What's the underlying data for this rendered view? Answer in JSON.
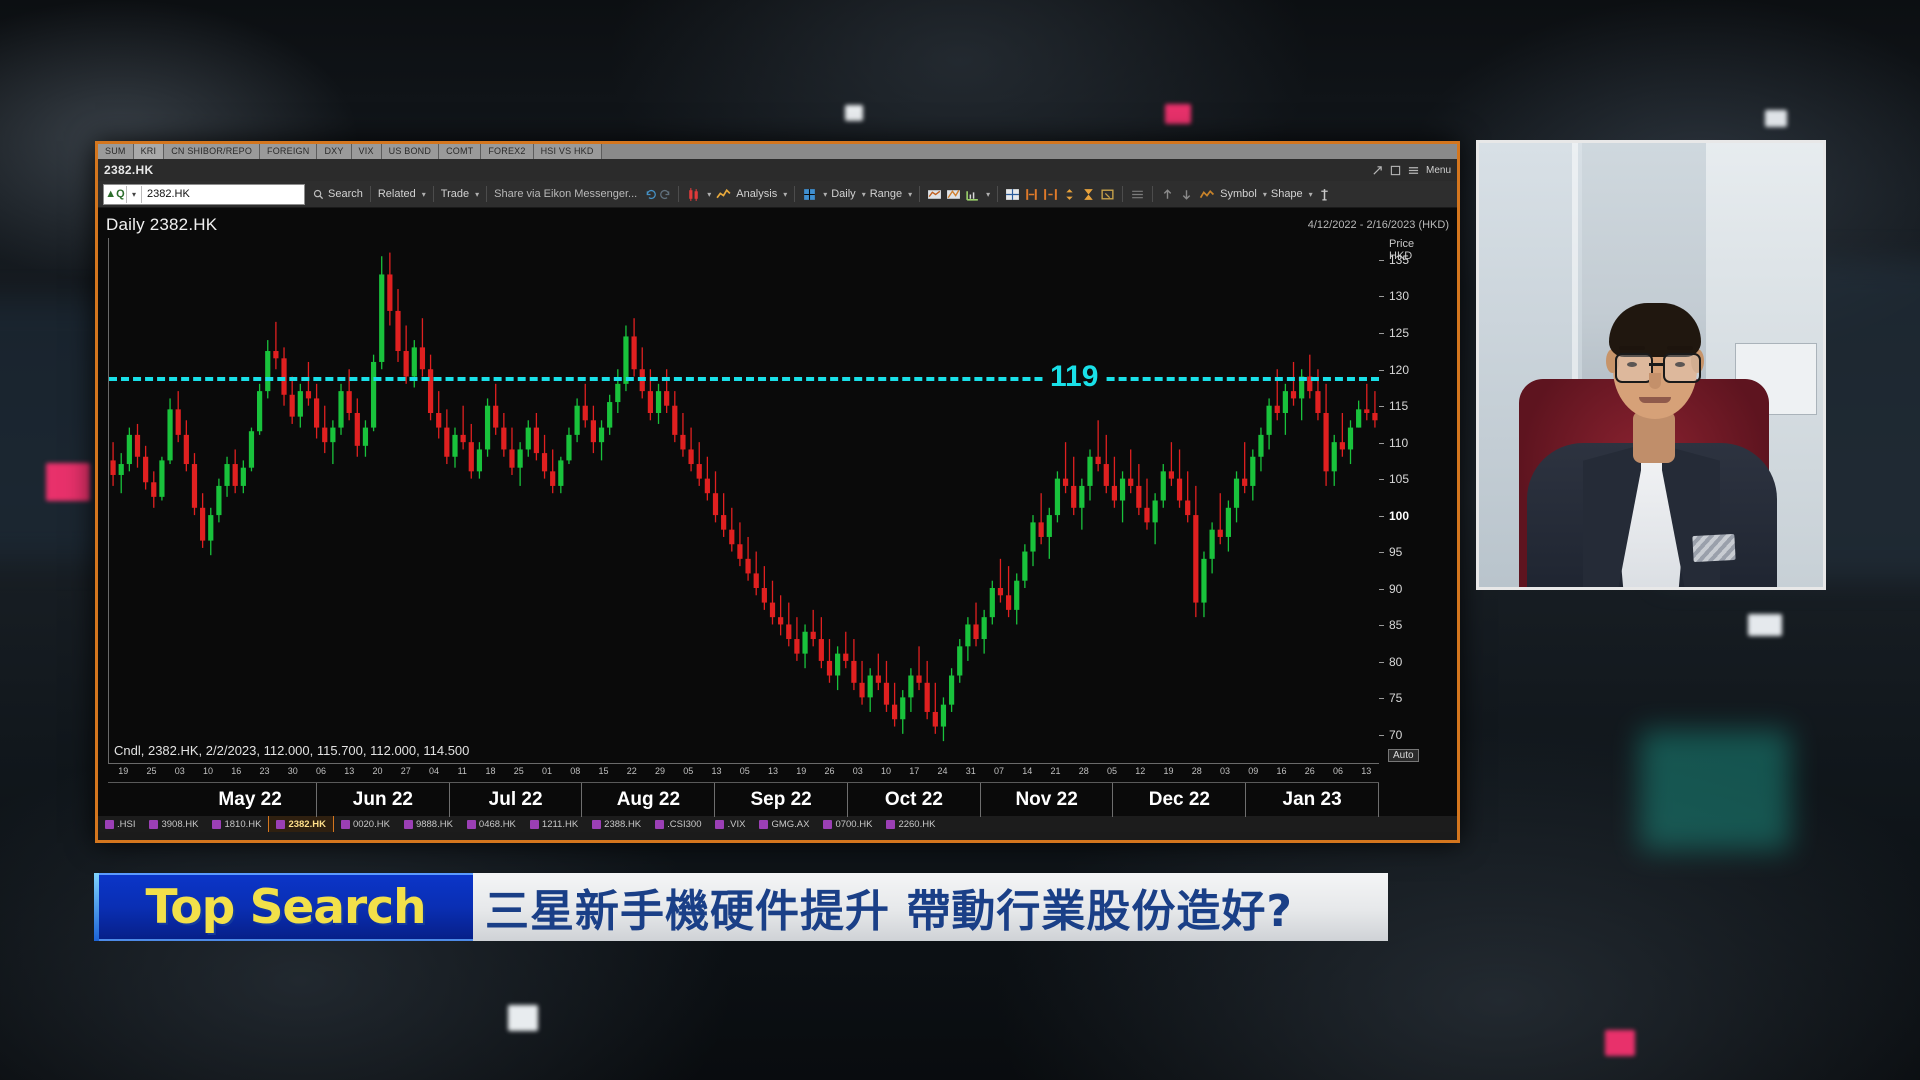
{
  "window": {
    "app_tabs": [
      "SUM",
      "KRI",
      "CN SHIBOR/REPO",
      "FOREIGN",
      "DXY",
      "VIX",
      "US BOND",
      "COMT",
      "FOREX2",
      "HSI VS HKD"
    ],
    "selected_app_tab": "KRI",
    "title": "2382.HK",
    "menu_label": "Menu"
  },
  "toolbar": {
    "quote_icon": "up-arrow-green",
    "search_symbol_value": "2382.HK",
    "search_label": "Search",
    "related_label": "Related",
    "trade_label": "Trade",
    "share_label": "Share via Eikon Messenger...",
    "analysis_label": "Analysis",
    "interval_label": "Daily",
    "range_label": "Range",
    "symbol_label": "Symbol",
    "shape_label": "Shape"
  },
  "chart_header": {
    "title": "Daily 2382.HK",
    "date_range": "4/12/2022 - 2/16/2023 (HKD)"
  },
  "chart_footer": {
    "ohlc_line": "Cndl, 2382.HK, 2/2/2023, 112.000, 115.700, 112.000, 114.500",
    "auto_label": "Auto"
  },
  "price_axis": {
    "header_line1": "Price",
    "header_line2": "HKD",
    "ticks": [
      135,
      130,
      125,
      120,
      115,
      110,
      105,
      100,
      95,
      90,
      85,
      80,
      75,
      70
    ],
    "bold_tick": 100
  },
  "level_line": {
    "label": "119",
    "value": 119,
    "color": "#19e0e8"
  },
  "ticker_bar": {
    "items": [
      ".HSI",
      "3908.HK",
      "1810.HK",
      "2382.HK",
      "0020.HK",
      "9888.HK",
      "0468.HK",
      "1211.HK",
      "2388.HK",
      ".CSI300",
      ".VIX",
      "GMG.AX",
      "0700.HK",
      "2260.HK"
    ],
    "selected": "2382.HK"
  },
  "lower_third": {
    "badge": "Top Search",
    "headline": "三星新手機硬件提升 帶動行業股份造好?",
    "badge_bg": "#0a2fb4",
    "badge_fg": "#f2e04a",
    "headline_fg": "#1a3f87"
  },
  "chart_data": {
    "type": "candlestick",
    "title": "Daily 2382.HK",
    "instrument": "2382.HK",
    "currency": "HKD",
    "xlabel": "",
    "ylabel": "Price HKD",
    "ylim": [
      66,
      138
    ],
    "grid": false,
    "date_range": "4/12/2022 - 2/16/2023",
    "month_labels": [
      "May 22",
      "Jun 22",
      "Jul 22",
      "Aug 22",
      "Sep 22",
      "Oct 22",
      "Nov 22",
      "Dec 22",
      "Jan 23"
    ],
    "day_ticks_left": [
      "19",
      "25",
      "03",
      "10",
      "16",
      "23",
      "30",
      "06",
      "13",
      "20",
      "27",
      "04",
      "11",
      "18",
      "25",
      "01",
      "08",
      "15",
      "22",
      "29",
      "05",
      "13"
    ],
    "day_ticks_right": [
      "05",
      "13",
      "19",
      "26",
      "03",
      "10",
      "17",
      "24",
      "31",
      "07",
      "14",
      "21",
      "28",
      "05",
      "12",
      "19",
      "28",
      "03",
      "09",
      "16",
      "26",
      "06",
      "13"
    ],
    "annotations": [
      {
        "type": "horizontal_line",
        "value": 119,
        "label": "119",
        "color": "#19e0e8",
        "style": "dashed"
      }
    ],
    "last_candle": {
      "date": "2/2/2023",
      "open": 112.0,
      "high": 115.7,
      "low": 112.0,
      "close": 114.5
    },
    "ohlc": [
      [
        107.5,
        110.0,
        104.0,
        105.5
      ],
      [
        105.5,
        108.5,
        103.0,
        107.0
      ],
      [
        107.0,
        112.0,
        106.0,
        111.0
      ],
      [
        111.0,
        112.5,
        106.5,
        108.0
      ],
      [
        108.0,
        109.5,
        103.5,
        104.5
      ],
      [
        104.5,
        106.0,
        101.0,
        102.5
      ],
      [
        102.5,
        108.0,
        102.0,
        107.5
      ],
      [
        107.5,
        116.0,
        107.0,
        114.5
      ],
      [
        114.5,
        117.0,
        110.0,
        111.0
      ],
      [
        111.0,
        113.0,
        106.0,
        107.0
      ],
      [
        107.0,
        108.5,
        100.0,
        101.0
      ],
      [
        101.0,
        103.0,
        95.5,
        96.5
      ],
      [
        96.5,
        101.0,
        94.5,
        100.0
      ],
      [
        100.0,
        105.0,
        99.0,
        104.0
      ],
      [
        104.0,
        108.0,
        102.5,
        107.0
      ],
      [
        107.0,
        109.0,
        103.0,
        104.0
      ],
      [
        104.0,
        107.5,
        103.0,
        106.5
      ],
      [
        106.5,
        112.0,
        106.0,
        111.5
      ],
      [
        111.5,
        118.0,
        111.0,
        117.0
      ],
      [
        117.0,
        124.0,
        116.0,
        122.5
      ],
      [
        122.5,
        126.5,
        120.0,
        121.5
      ],
      [
        121.5,
        123.0,
        115.0,
        116.5
      ],
      [
        116.5,
        119.0,
        112.5,
        113.5
      ],
      [
        113.5,
        118.0,
        112.0,
        117.0
      ],
      [
        117.0,
        121.0,
        115.0,
        116.0
      ],
      [
        116.0,
        118.0,
        110.5,
        112.0
      ],
      [
        112.0,
        115.0,
        108.5,
        110.0
      ],
      [
        110.0,
        113.0,
        107.0,
        112.0
      ],
      [
        112.0,
        118.0,
        111.0,
        117.0
      ],
      [
        117.0,
        120.0,
        113.0,
        114.0
      ],
      [
        114.0,
        116.0,
        108.0,
        109.5
      ],
      [
        109.5,
        113.0,
        108.0,
        112.0
      ],
      [
        112.0,
        122.0,
        111.5,
        121.0
      ],
      [
        121.0,
        135.5,
        120.0,
        133.0
      ],
      [
        133.0,
        136.0,
        126.0,
        128.0
      ],
      [
        128.0,
        131.0,
        121.0,
        122.5
      ],
      [
        122.5,
        126.0,
        118.0,
        119.0
      ],
      [
        119.0,
        124.0,
        117.5,
        123.0
      ],
      [
        123.0,
        127.0,
        119.0,
        120.0
      ],
      [
        120.0,
        122.0,
        113.0,
        114.0
      ],
      [
        114.0,
        117.0,
        110.5,
        112.0
      ],
      [
        112.0,
        114.5,
        107.0,
        108.0
      ],
      [
        108.0,
        112.0,
        106.5,
        111.0
      ],
      [
        111.0,
        115.0,
        109.0,
        110.0
      ],
      [
        110.0,
        112.5,
        105.0,
        106.0
      ],
      [
        106.0,
        110.0,
        105.0,
        109.0
      ],
      [
        109.0,
        116.0,
        108.0,
        115.0
      ],
      [
        115.0,
        118.0,
        111.0,
        112.0
      ],
      [
        112.0,
        114.0,
        108.0,
        109.0
      ],
      [
        109.0,
        112.0,
        105.5,
        106.5
      ],
      [
        106.5,
        110.0,
        104.0,
        109.0
      ],
      [
        109.0,
        113.0,
        108.0,
        112.0
      ],
      [
        112.0,
        114.0,
        107.5,
        108.5
      ],
      [
        108.5,
        111.0,
        105.0,
        106.0
      ],
      [
        106.0,
        109.0,
        103.0,
        104.0
      ],
      [
        104.0,
        108.0,
        103.0,
        107.5
      ],
      [
        107.5,
        112.0,
        107.0,
        111.0
      ],
      [
        111.0,
        116.0,
        110.0,
        115.0
      ],
      [
        115.0,
        118.0,
        112.0,
        113.0
      ],
      [
        113.0,
        115.0,
        108.5,
        110.0
      ],
      [
        110.0,
        113.0,
        107.5,
        112.0
      ],
      [
        112.0,
        116.5,
        111.0,
        115.5
      ],
      [
        115.5,
        120.0,
        114.0,
        118.0
      ],
      [
        118.0,
        126.0,
        117.0,
        124.5
      ],
      [
        124.5,
        127.0,
        119.0,
        120.0
      ],
      [
        120.0,
        123.0,
        116.0,
        117.0
      ],
      [
        117.0,
        120.0,
        113.0,
        114.0
      ],
      [
        114.0,
        118.0,
        112.5,
        117.0
      ],
      [
        117.0,
        120.0,
        114.0,
        115.0
      ],
      [
        115.0,
        117.0,
        110.0,
        111.0
      ],
      [
        111.0,
        114.0,
        108.0,
        109.0
      ],
      [
        109.0,
        112.0,
        106.0,
        107.0
      ],
      [
        107.0,
        110.0,
        104.0,
        105.0
      ],
      [
        105.0,
        108.0,
        102.0,
        103.0
      ],
      [
        103.0,
        106.0,
        99.0,
        100.0
      ],
      [
        100.0,
        103.0,
        97.0,
        98.0
      ],
      [
        98.0,
        101.0,
        95.0,
        96.0
      ],
      [
        96.0,
        99.0,
        93.0,
        94.0
      ],
      [
        94.0,
        97.0,
        91.0,
        92.0
      ],
      [
        92.0,
        95.0,
        89.0,
        90.0
      ],
      [
        90.0,
        93.0,
        87.0,
        88.0
      ],
      [
        88.0,
        91.0,
        85.0,
        86.0
      ],
      [
        86.0,
        89.0,
        83.5,
        85.0
      ],
      [
        85.0,
        88.0,
        82.0,
        83.0
      ],
      [
        83.0,
        86.0,
        80.0,
        81.0
      ],
      [
        81.0,
        85.0,
        79.0,
        84.0
      ],
      [
        84.0,
        87.0,
        82.0,
        83.0
      ],
      [
        83.0,
        86.0,
        79.0,
        80.0
      ],
      [
        80.0,
        83.0,
        77.0,
        78.0
      ],
      [
        78.0,
        82.0,
        76.0,
        81.0
      ],
      [
        81.0,
        84.0,
        79.0,
        80.0
      ],
      [
        80.0,
        83.0,
        76.0,
        77.0
      ],
      [
        77.0,
        80.0,
        74.0,
        75.0
      ],
      [
        75.0,
        79.0,
        73.0,
        78.0
      ],
      [
        78.0,
        81.0,
        76.0,
        77.0
      ],
      [
        77.0,
        80.0,
        73.0,
        74.0
      ],
      [
        74.0,
        77.0,
        71.0,
        72.0
      ],
      [
        72.0,
        76.0,
        70.0,
        75.0
      ],
      [
        75.0,
        79.0,
        73.0,
        78.0
      ],
      [
        78.0,
        82.0,
        76.0,
        77.0
      ],
      [
        77.0,
        80.0,
        72.0,
        73.0
      ],
      [
        73.0,
        77.0,
        70.0,
        71.0
      ],
      [
        71.0,
        75.0,
        69.0,
        74.0
      ],
      [
        74.0,
        79.0,
        73.0,
        78.0
      ],
      [
        78.0,
        83.0,
        77.0,
        82.0
      ],
      [
        82.0,
        86.0,
        80.0,
        85.0
      ],
      [
        85.0,
        88.0,
        82.0,
        83.0
      ],
      [
        83.0,
        87.0,
        81.0,
        86.0
      ],
      [
        86.0,
        91.0,
        85.0,
        90.0
      ],
      [
        90.0,
        94.0,
        88.0,
        89.0
      ],
      [
        89.0,
        93.0,
        86.0,
        87.0
      ],
      [
        87.0,
        92.0,
        85.0,
        91.0
      ],
      [
        91.0,
        96.0,
        90.0,
        95.0
      ],
      [
        95.0,
        100.0,
        93.0,
        99.0
      ],
      [
        99.0,
        103.0,
        96.0,
        97.0
      ],
      [
        97.0,
        101.0,
        94.0,
        100.0
      ],
      [
        100.0,
        106.0,
        99.0,
        105.0
      ],
      [
        105.0,
        110.0,
        103.0,
        104.0
      ],
      [
        104.0,
        108.0,
        100.0,
        101.0
      ],
      [
        101.0,
        105.0,
        98.0,
        104.0
      ],
      [
        104.0,
        109.0,
        102.0,
        108.0
      ],
      [
        108.0,
        113.0,
        106.0,
        107.0
      ],
      [
        107.0,
        111.0,
        103.0,
        104.0
      ],
      [
        104.0,
        108.0,
        101.0,
        102.0
      ],
      [
        102.0,
        106.0,
        99.0,
        105.0
      ],
      [
        105.0,
        109.0,
        103.0,
        104.0
      ],
      [
        104.0,
        107.0,
        100.0,
        101.0
      ],
      [
        101.0,
        105.0,
        98.0,
        99.0
      ],
      [
        99.0,
        103.0,
        96.0,
        102.0
      ],
      [
        102.0,
        107.0,
        101.0,
        106.0
      ],
      [
        106.0,
        110.0,
        104.0,
        105.0
      ],
      [
        105.0,
        109.0,
        101.0,
        102.0
      ],
      [
        102.0,
        106.0,
        99.0,
        100.0
      ],
      [
        100.0,
        104.0,
        86.0,
        88.0
      ],
      [
        88.0,
        95.0,
        86.0,
        94.0
      ],
      [
        94.0,
        99.0,
        92.0,
        98.0
      ],
      [
        98.0,
        103.0,
        96.0,
        97.0
      ],
      [
        97.0,
        102.0,
        95.0,
        101.0
      ],
      [
        101.0,
        106.0,
        99.0,
        105.0
      ],
      [
        105.0,
        110.0,
        103.0,
        104.0
      ],
      [
        104.0,
        109.0,
        102.0,
        108.0
      ],
      [
        108.0,
        112.0,
        106.0,
        111.0
      ],
      [
        111.0,
        116.0,
        109.0,
        115.0
      ],
      [
        115.0,
        120.0,
        113.0,
        114.0
      ],
      [
        114.0,
        118.0,
        111.0,
        117.0
      ],
      [
        117.0,
        121.0,
        115.0,
        116.0
      ],
      [
        116.0,
        120.0,
        113.0,
        119.0
      ],
      [
        119.0,
        122.0,
        116.0,
        117.0
      ],
      [
        117.0,
        120.0,
        113.0,
        114.0
      ],
      [
        114.0,
        118.0,
        104.0,
        106.0
      ],
      [
        106.0,
        111.0,
        104.0,
        110.0
      ],
      [
        110.0,
        114.0,
        108.0,
        109.0
      ],
      [
        109.0,
        113.0,
        107.0,
        112.0
      ],
      [
        112.0,
        115.7,
        112.0,
        114.5
      ],
      [
        114.5,
        118.0,
        113.0,
        114.0
      ],
      [
        114.0,
        117.0,
        112.0,
        113.0
      ]
    ]
  }
}
